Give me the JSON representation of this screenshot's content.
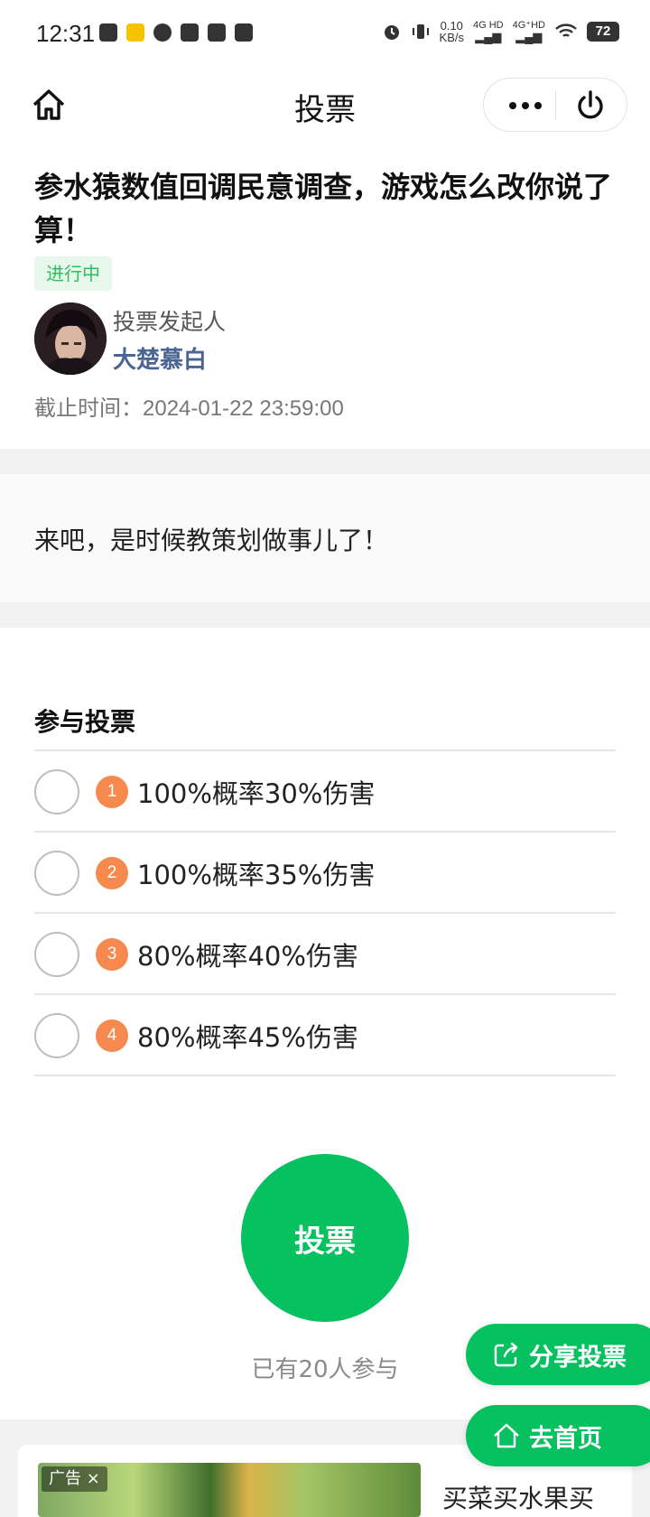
{
  "status_bar": {
    "time": "12:31",
    "net_speed": "0.10",
    "net_unit": "KB/s",
    "signal1": "4G HD",
    "signal2": "4G⁺HD",
    "battery": "72"
  },
  "nav": {
    "title": "投票"
  },
  "poll": {
    "title": "参水猿数值回调民意调查，游戏怎么改你说了算！",
    "status": "进行中",
    "initiator_label": "投票发起人",
    "initiator_name": "大楚慕白",
    "deadline_label": "截止时间：",
    "deadline_value": "2024-01-22 23:59:00",
    "description": "来吧，是时候教策划做事儿了！"
  },
  "vote": {
    "heading": "参与投票",
    "options": [
      {
        "num": "1",
        "label": "100%概率30%伤害"
      },
      {
        "num": "2",
        "label": "100%概率35%伤害"
      },
      {
        "num": "3",
        "label": "80%概率40%伤害"
      },
      {
        "num": "4",
        "label": "80%概率45%伤害"
      }
    ],
    "button_label": "投票",
    "participants": "已有20人参与"
  },
  "floating": {
    "share_label": "分享投票",
    "home_label": "去首页"
  },
  "ad": {
    "tag": "广告 ×",
    "text": "买菜买水果买"
  },
  "colors": {
    "accent_green": "#07c160",
    "number_badge": "#f5894e",
    "name_blue": "#4a6593"
  }
}
